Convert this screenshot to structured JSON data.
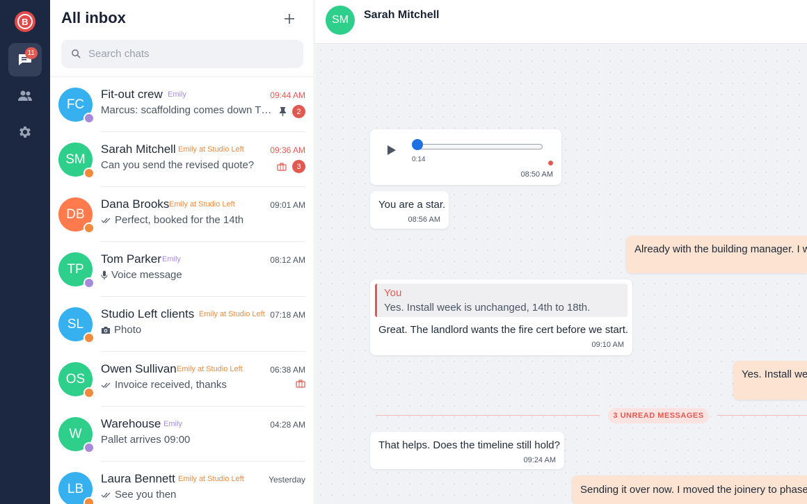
{
  "rail": {
    "logo_letter": "B",
    "chats_badge": "11"
  },
  "list": {
    "title": "All inbox",
    "search_placeholder": "Search chats"
  },
  "chats": [
    {
      "initials": "FC",
      "name": "Fit-out crew",
      "owner": "Emily",
      "time": "09:44 AM",
      "preview": "Marcus: scaffolding comes down Thu...",
      "count": "2"
    },
    {
      "initials": "SM",
      "name": "Sarah Mitchell",
      "owner": "Emily at Studio Left",
      "time": "09:36 AM",
      "preview": "Can you send the revised quote?",
      "count": "3"
    },
    {
      "initials": "DB",
      "name": "Dana Brooks",
      "owner": "Emily at Studio Left",
      "time": "09:01 AM",
      "preview": "Perfect, booked for the 14th"
    },
    {
      "initials": "TP",
      "name": "Tom Parker",
      "owner": "Emily",
      "time": "08:12 AM",
      "preview": "Voice message"
    },
    {
      "initials": "SL",
      "name": "Studio Left clients",
      "owner": "Emily at Studio Left",
      "time": "07:18 AM",
      "preview": "Photo"
    },
    {
      "initials": "OS",
      "name": "Owen Sullivan",
      "owner": "Emily at Studio Left",
      "time": "06:38 AM",
      "preview": "Invoice received, thanks"
    },
    {
      "initials": "W",
      "name": "Warehouse",
      "owner": "Emily",
      "time": "04:28 AM",
      "preview": "Pallet arrives 09:00"
    },
    {
      "initials": "LB",
      "name": "Laura Bennett",
      "owner": "Emily at Studio Left",
      "time": "Yesterday",
      "preview": "See you then"
    }
  ],
  "colors": {
    "accent_red": "#e05a52",
    "owner_purple": "#a78bdb",
    "owner_orange": "#f08a3c",
    "outgoing_bubble": "#fde3d1"
  },
  "conversation": {
    "initials": "SM",
    "name": "Sarah Mitchell",
    "voice": {
      "duration": "0:14",
      "time": "08:50 AM",
      "progress": 0
    },
    "messages": [
      {
        "text": "You are a star.",
        "time": "08:56 AM"
      },
      {
        "text": "Already with the building manager. I wi"
      },
      {
        "quote_author": "You",
        "quote_text": "Yes. Install week is unchanged, 14th to 18th.",
        "text": "Great. The landlord wants the fire cert before we start.",
        "time": "09:10 AM"
      },
      {
        "text": "Yes. Install wee"
      },
      {
        "text": "That helps. Does the timeline still hold?",
        "time": "09:24 AM"
      },
      {
        "text": "Sending it over now. I moved the joinery to phase t"
      }
    ],
    "unread_label": "3 UNREAD MESSAGES"
  }
}
